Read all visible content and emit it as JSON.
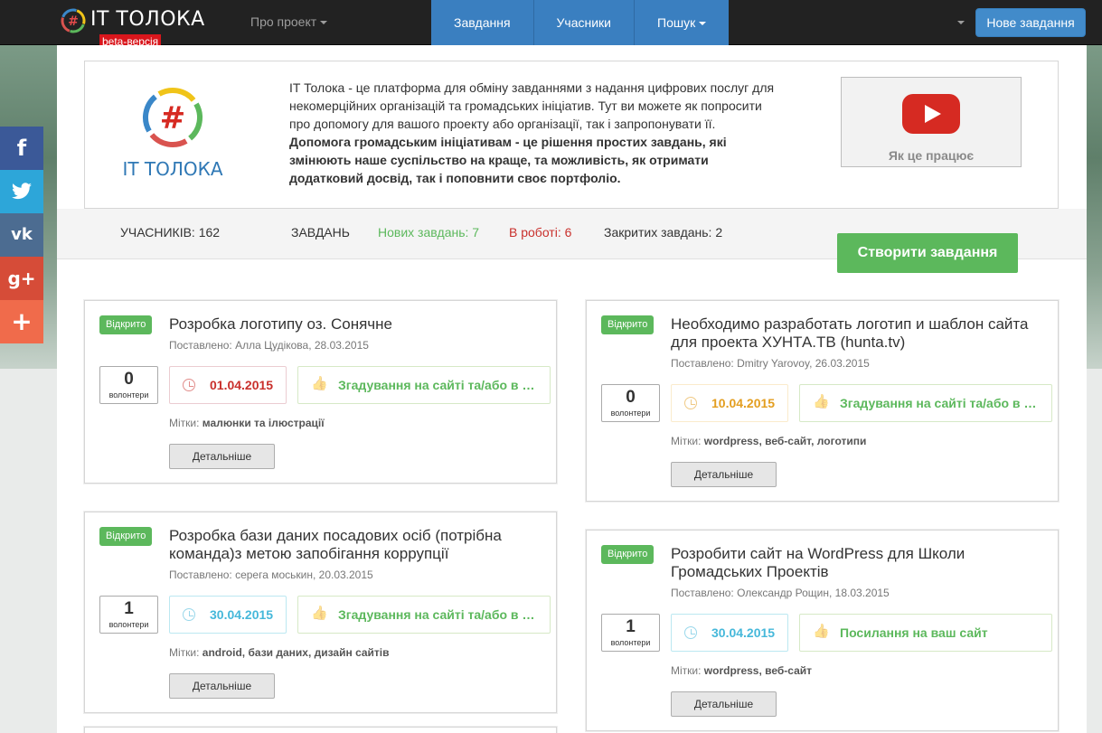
{
  "navbar": {
    "brand": "IT ТОЛОКА",
    "beta": "beta-версія",
    "about": "Про проект",
    "items": [
      "Завдання",
      "Учасники",
      "Пошук"
    ],
    "new_task": "Нове завдання"
  },
  "hero": {
    "text_normal": "IT Толока - це платформа для обміну завданнями з надання цифрових послуг для некомерційних організацій та громадських ініціатив. Тут ви можете як попросити про допомогу для вашого проекту або організації, так і запропонувати її. ",
    "text_bold": "Допомога громадським ініціативам - це рішення простих завдань, які змінюють наше суспільство на краще, та можливість, як отримати додатковий досвід, так і поповнити своє портфоліо.",
    "logo_text": "IT ТОЛОКА",
    "video_label": "Як це працює"
  },
  "stats": {
    "members": "УЧАСНИКІВ: 162",
    "tasks": "ЗАВДАНЬ",
    "new": "Нових завдань: 7",
    "in_progress": "В роботі: 6",
    "closed": "Закритих завдань: 2",
    "create": "Створити завдання"
  },
  "tasks": [
    {
      "status": "Відкрито",
      "title": "Розробка логотипу оз. Сонячне",
      "posted": "Поставлено: Алла Цудікова, 28.03.2015",
      "volunteers": "0",
      "volunteers_label": "волонтери",
      "date": "01.04.2015",
      "date_color": "red",
      "reward": "Згадування на сайті та/або в соціальних мережах",
      "tags_label": "Мітки:",
      "tags": "малюнки та ілюстрації",
      "details": "Детальніше"
    },
    {
      "status": "Відкрито",
      "title": "Необходимо разработать логотип и шаблон сайта для проекта ХУНТА.ТВ (hunta.tv)",
      "posted": "Поставлено: Dmitry Yarovoy, 26.03.2015",
      "volunteers": "0",
      "volunteers_label": "волонтери",
      "date": "10.04.2015",
      "date_color": "orange",
      "reward": "Згадування на сайті та/або в соціальних мережах",
      "tags_label": "Мітки:",
      "tags": "wordpress, веб-сайт, логотипи",
      "details": "Детальніше"
    },
    {
      "status": "Відкрито",
      "title": "Розробка бази даних посадових осіб (потрібна команда)з метою запобігання коррупції",
      "posted": "Поставлено: серега моськин, 20.03.2015",
      "volunteers": "1",
      "volunteers_label": "волонтери",
      "date": "30.04.2015",
      "date_color": "blue",
      "reward": "Згадування на сайті та/або в соціальних мережах",
      "tags_label": "Мітки:",
      "tags": "android, бази даних, дизайн сайтів",
      "details": "Детальніше"
    },
    {
      "status": "Відкрито",
      "title": "Розробити сайт на WordPress для Школи Громадських Проектів",
      "posted": "Поставлено: Олександр Рощин, 18.03.2015",
      "volunteers": "1",
      "volunteers_label": "волонтери",
      "date": "30.04.2015",
      "date_color": "blue",
      "reward": "Посилання на ваш сайт",
      "tags_label": "Мітки:",
      "tags": "wordpress, веб-сайт",
      "details": "Детальніше"
    }
  ],
  "social": [
    {
      "icon": "facebook-icon",
      "glyph": "f",
      "color": "#3b5998"
    },
    {
      "icon": "twitter-icon",
      "glyph": "t",
      "color": "#2da6d9"
    },
    {
      "icon": "vk-icon",
      "glyph": "vk",
      "color": "#4c6c91"
    },
    {
      "icon": "google-plus-icon",
      "glyph": "g+",
      "color": "#d64c38"
    },
    {
      "icon": "share-more-icon",
      "glyph": "+",
      "color": "#f06b4b"
    }
  ]
}
